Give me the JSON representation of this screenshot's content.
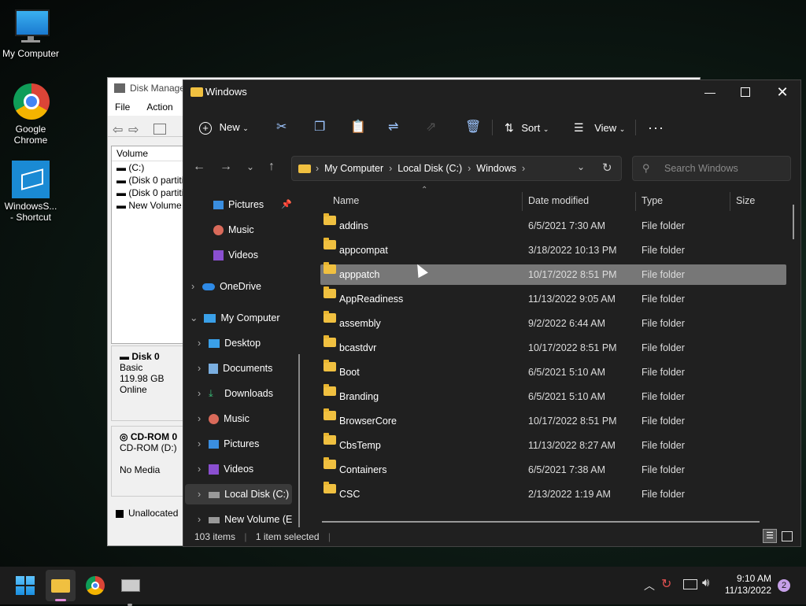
{
  "desktop": {
    "icons": [
      {
        "label": "My Computer",
        "icon": "monitor-icon"
      },
      {
        "label": "Google Chrome",
        "icon": "chrome-icon"
      },
      {
        "label": "WindowsS... - Shortcut",
        "icon": "shortcut-icon"
      }
    ]
  },
  "disk_management": {
    "title": "Disk Manage",
    "menu": [
      "File",
      "Action"
    ],
    "column_volume": "Volume",
    "volumes": [
      "(C:)",
      "(Disk 0 partiti",
      "(Disk 0 partiti",
      "New Volume"
    ],
    "disk0": {
      "name": "Disk 0",
      "type": "Basic",
      "size": "119.98 GB",
      "status": "Online"
    },
    "cdrom": {
      "name": "CD-ROM 0",
      "drive": "CD-ROM (D:)",
      "media": "No Media"
    },
    "legend_unallocated": "Unallocated"
  },
  "explorer": {
    "title": "Windows",
    "toolbar": {
      "new": "New",
      "sort": "Sort",
      "view": "View"
    },
    "address": [
      "My Computer",
      "Local Disk (C:)",
      "Windows"
    ],
    "search_placeholder": "Search Windows",
    "nav": [
      {
        "label": "Pictures",
        "icon": "pictures-icon",
        "pinned": true
      },
      {
        "label": "Music",
        "icon": "music-icon"
      },
      {
        "label": "Videos",
        "icon": "videos-icon"
      },
      {
        "label": "OneDrive",
        "icon": "onedrive-icon"
      },
      {
        "label": "My Computer",
        "icon": "computer-icon"
      },
      {
        "label": "Desktop",
        "icon": "desktop-icon"
      },
      {
        "label": "Documents",
        "icon": "documents-icon"
      },
      {
        "label": "Downloads",
        "icon": "downloads-icon"
      },
      {
        "label": "Music",
        "icon": "music-icon"
      },
      {
        "label": "Pictures",
        "icon": "pictures-icon"
      },
      {
        "label": "Videos",
        "icon": "videos-icon"
      },
      {
        "label": "Local Disk (C:)",
        "icon": "drive-icon",
        "selected": true
      },
      {
        "label": "New Volume (E",
        "icon": "drive-icon"
      }
    ],
    "columns": [
      "Name",
      "Date modified",
      "Type",
      "Size"
    ],
    "files": [
      {
        "name": "addins",
        "date": "6/5/2021 7:30 AM",
        "type": "File folder"
      },
      {
        "name": "appcompat",
        "date": "3/18/2022 10:13 PM",
        "type": "File folder"
      },
      {
        "name": "apppatch",
        "date": "10/17/2022 8:51 PM",
        "type": "File folder",
        "selected": true
      },
      {
        "name": "AppReadiness",
        "date": "11/13/2022 9:05 AM",
        "type": "File folder"
      },
      {
        "name": "assembly",
        "date": "9/2/2022 6:44 AM",
        "type": "File folder"
      },
      {
        "name": "bcastdvr",
        "date": "10/17/2022 8:51 PM",
        "type": "File folder"
      },
      {
        "name": "Boot",
        "date": "6/5/2021 5:10 AM",
        "type": "File folder"
      },
      {
        "name": "Branding",
        "date": "6/5/2021 5:10 AM",
        "type": "File folder"
      },
      {
        "name": "BrowserCore",
        "date": "10/17/2022 8:51 PM",
        "type": "File folder"
      },
      {
        "name": "CbsTemp",
        "date": "11/13/2022 8:27 AM",
        "type": "File folder"
      },
      {
        "name": "Containers",
        "date": "6/5/2021 7:38 AM",
        "type": "File folder"
      },
      {
        "name": "CSC",
        "date": "2/13/2022 1:19 AM",
        "type": "File folder"
      }
    ],
    "status_items": "103 items",
    "status_selected": "1 item selected"
  },
  "taskbar": {
    "time": "9:10 AM",
    "date": "11/13/2022",
    "notifications": "2"
  }
}
